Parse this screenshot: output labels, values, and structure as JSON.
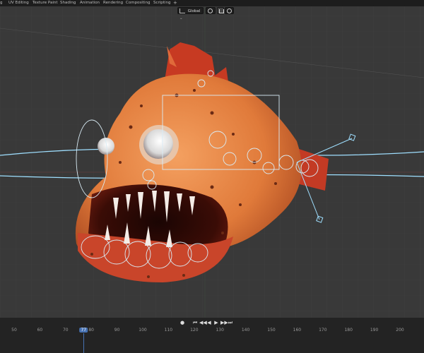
{
  "workspace_tabs": [
    "g",
    "UV Editing",
    "Texture Paint",
    "Shading",
    "Animation",
    "Rendering",
    "Compositing",
    "Scripting"
  ],
  "add_tab_label": "+",
  "viewport_header": {
    "transform_orientation": "Global",
    "dropdown_glyph": "⌄"
  },
  "icons": {
    "orientation": "axes-icon",
    "pivot": "link-icon",
    "snap": "magnet-icon",
    "proportional": "circle-icon"
  },
  "timeline": {
    "frame_labels": [
      "50",
      "60",
      "70",
      "77",
      "80",
      "90",
      "100",
      "110",
      "120",
      "130",
      "140",
      "150",
      "160",
      "170",
      "180",
      "190",
      "200"
    ],
    "current_frame": "77",
    "playback_buttons": [
      "⏮",
      "◀◀",
      "◀",
      "▶",
      "▶▶",
      "⏭"
    ]
  },
  "colors": {
    "ui_bg": "#1d1d1d",
    "viewport_bg": "#393939",
    "rig_lines": "#9fdfff",
    "fish_body": "#e07a3a",
    "fin": "#c73a22",
    "current_frame": "#4772b3"
  }
}
